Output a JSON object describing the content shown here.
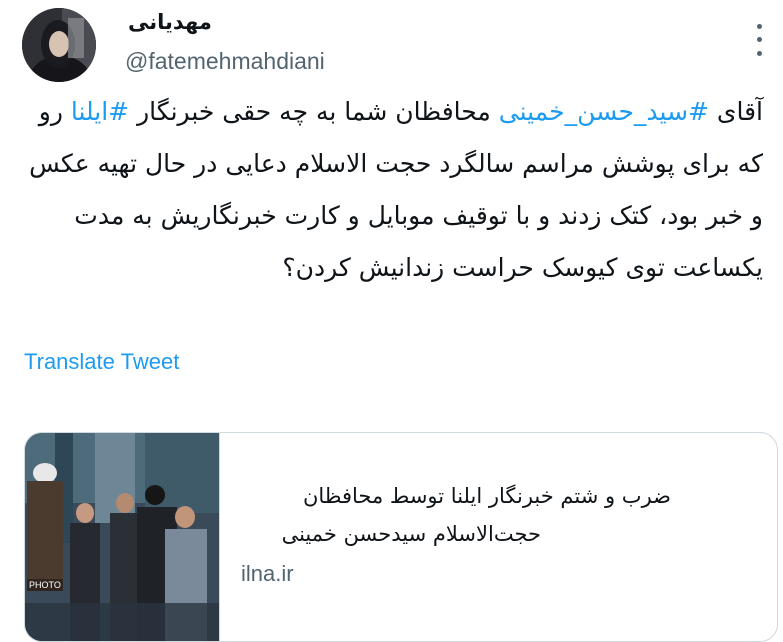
{
  "author": {
    "display_name": "مهدیانی",
    "handle": "@fatemehmahdiani"
  },
  "tweet": {
    "segments": [
      {
        "text": "آقای ",
        "type": "text"
      },
      {
        "text": "#سید_حسن_خمینی",
        "type": "hashtag"
      },
      {
        "text": " محافظان شما به چه حقی خبرنگار ",
        "type": "text"
      },
      {
        "text": "#ایلنا",
        "type": "hashtag"
      },
      {
        "text": " رو که برای پوشش مراسم سالگرد حجت الاسلام دعایی در حال تهیه عکس و خبر بود، کتک زدند و با توقیف موبایل و کارت خبرنگاریش به مدت یکساعت توی کیوسک حراست زندانیش کردن؟",
        "type": "text"
      }
    ]
  },
  "translate_label": "Translate Tweet",
  "link_card": {
    "title_line1": "ضرب و شتم خبرنگار ایلنا توسط محافظان",
    "title_line2": "حجت‌الاسلام سیدحسن خمینی",
    "domain": "ilna.ir",
    "image_watermark": "PHOTO"
  },
  "colors": {
    "accent": "#1d9bf0",
    "text": "#0f1419",
    "secondary": "#536471",
    "border": "#cfd9de"
  },
  "icons": {
    "more": "more-vertical-icon"
  }
}
